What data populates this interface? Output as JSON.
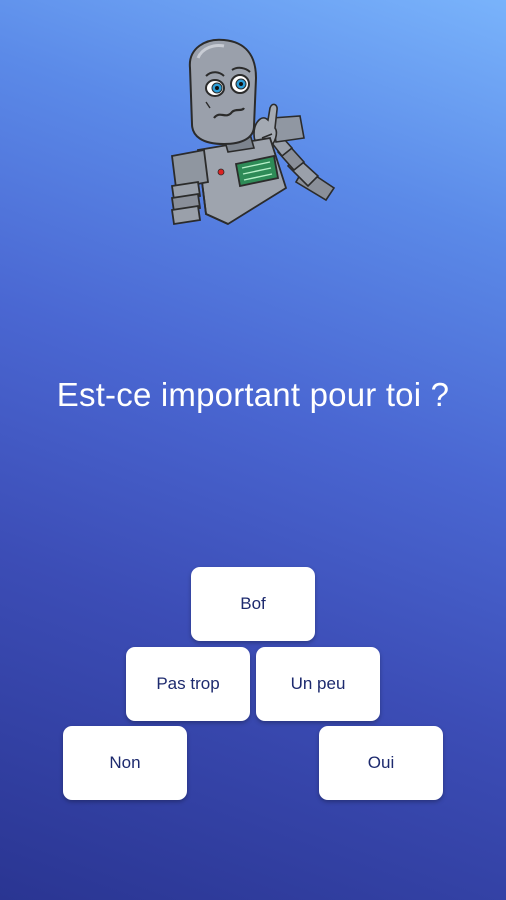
{
  "question": {
    "text": "Est-ce important pour toi ?"
  },
  "answers": [
    {
      "label": "Bof"
    },
    {
      "label": "Pas trop"
    },
    {
      "label": "Un peu"
    },
    {
      "label": "Non"
    },
    {
      "label": "Oui"
    }
  ],
  "colors": {
    "gradient_top": "#79b3fb",
    "gradient_bottom": "#2a3592",
    "button_bg": "#ffffff",
    "button_text": "#1d2a6e",
    "question_text": "#ffffff"
  },
  "mascot": {
    "icon": "thinking-robot-icon"
  }
}
